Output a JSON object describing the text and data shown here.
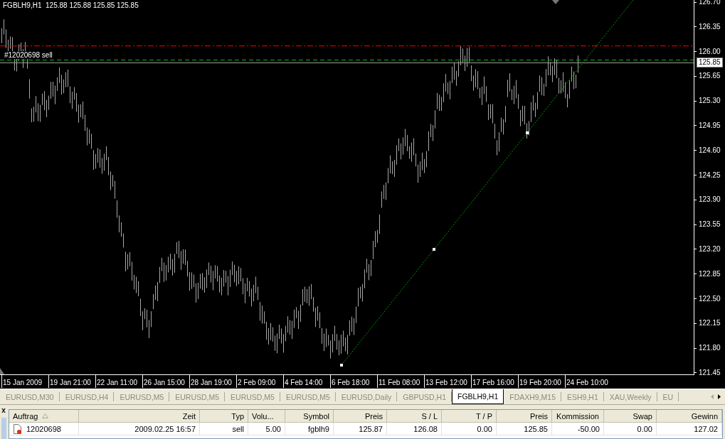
{
  "chart": {
    "header": {
      "symbol": "FGBLH9,H1",
      "prices": [
        "125.88",
        "125.88",
        "125.85",
        "125.85"
      ]
    },
    "order_label": "#12020698 sell",
    "current_price": "125.85",
    "y_labels": [
      "126.70",
      "126.35",
      "126.00",
      "125.65",
      "125.30",
      "124.95",
      "124.60",
      "124.25",
      "123.90",
      "123.55",
      "123.20",
      "122.85",
      "122.50",
      "122.15",
      "121.80",
      "121.45"
    ],
    "x_labels": [
      "15 Jan 2009",
      "19 Jan 21:00",
      "22 Jan 11:00",
      "26 Jan 15:00",
      "28 Jan 19:00",
      "2 Feb 09:00",
      "4 Feb 14:00",
      "6 Feb 18:00",
      "11 Feb 08:00",
      "13 Feb 12:00",
      "17 Feb 16:00",
      "19 Feb 20:00",
      "24 Feb 10:00"
    ]
  },
  "tabs": [
    {
      "label": "EURUSD,M30",
      "selected": false
    },
    {
      "label": "EURUSD,H4",
      "selected": false
    },
    {
      "label": "EURUSD,M5",
      "selected": false
    },
    {
      "label": "EURUSD,M5",
      "selected": false
    },
    {
      "label": "EURUSD,M5",
      "selected": false
    },
    {
      "label": "EURUSD,M5",
      "selected": false
    },
    {
      "label": "EURUSD,Daily",
      "selected": false
    },
    {
      "label": "GBPUSD,H1",
      "selected": false
    },
    {
      "label": "FGBLH9,H1",
      "selected": true
    },
    {
      "label": "FDAXH9,M15",
      "selected": false
    },
    {
      "label": "ESH9,H1",
      "selected": false
    },
    {
      "label": "XAU,Weekly",
      "selected": false
    },
    {
      "label": "EU",
      "selected": false
    }
  ],
  "terminal": {
    "close": "x",
    "columns": [
      {
        "label": "Auftrag",
        "sorted": true
      },
      {
        "label": "Zeit",
        "sorted": false
      },
      {
        "label": "Typ",
        "sorted": false
      },
      {
        "label": "Volu...",
        "sorted": false
      },
      {
        "label": "Symbol",
        "sorted": false
      },
      {
        "label": "Preis",
        "sorted": false
      },
      {
        "label": "S / L",
        "sorted": false
      },
      {
        "label": "T / P",
        "sorted": false
      },
      {
        "label": "Preis",
        "sorted": false
      },
      {
        "label": "Kommission",
        "sorted": false
      },
      {
        "label": "Swap",
        "sorted": false
      },
      {
        "label": "Gewinn",
        "sorted": false
      }
    ],
    "rows": [
      {
        "cells": [
          "12020698",
          "2009.02.25 16:57",
          "sell",
          "5.00",
          "fgblh9",
          "125.87",
          "126.08",
          "0.00",
          "125.85",
          "-50.00",
          "0.00",
          "127.02"
        ]
      }
    ]
  }
}
